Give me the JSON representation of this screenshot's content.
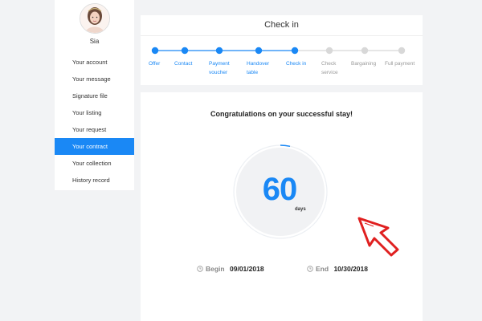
{
  "user": {
    "name": "Sia"
  },
  "sidebar": {
    "items": [
      {
        "label": "Your account"
      },
      {
        "label": "Your message"
      },
      {
        "label": "Signature file"
      },
      {
        "label": "Your listing"
      },
      {
        "label": "Your request"
      },
      {
        "label": "Your contract",
        "active": true
      },
      {
        "label": "Your collection"
      },
      {
        "label": "History record"
      }
    ]
  },
  "checkin": {
    "title": "Check in",
    "steps": [
      {
        "label": "Offer",
        "done": true
      },
      {
        "label": "Contact",
        "done": true
      },
      {
        "label": "Payment\nvoucher",
        "done": true
      },
      {
        "label": "Handover\ntable",
        "done": true
      },
      {
        "label": "Check in",
        "done": true
      },
      {
        "label": "Check\nservice",
        "done": false
      },
      {
        "label": "Bargaining",
        "done": false
      },
      {
        "label": "Full payment",
        "done": false
      }
    ]
  },
  "stay": {
    "message": "Congratulations on your successful stay!",
    "days": "60",
    "days_unit": "days",
    "begin_label": "Begin",
    "begin_date": "09/01/2018",
    "end_label": "End",
    "end_date": "10/30/2018"
  },
  "colors": {
    "accent": "#1a88f5",
    "inactive": "#d8d8d8",
    "cursor": "#e02020"
  }
}
